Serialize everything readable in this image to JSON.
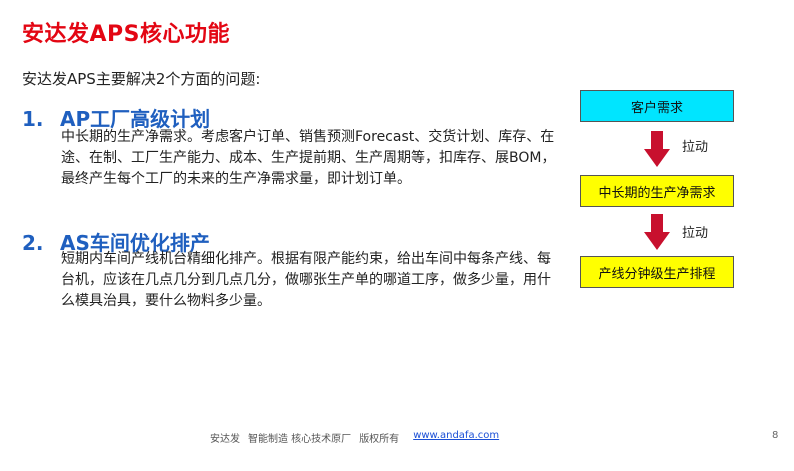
{
  "slide": {
    "title": "安达发APS核心功能",
    "intro": "安达发APS主要解决2个方面的问题:",
    "sections": [
      {
        "number": "1.",
        "heading": "AP工厂高级计划",
        "body": "中长期的生产净需求。考虑客户订单、销售预测Forecast、交货计划、库存、在途、在制、工厂生产能力、成本、生产提前期、生产周期等，扣库存、展BOM，最终产生每个工厂的未来的生产净需求量，即计划订单。"
      },
      {
        "number": "2.",
        "heading": "AS车间优化排产",
        "body": "短期内车间产线机台精细化排产。根据有限产能约束，给出车间中每条产线、每台机，应该在几点几分到几点几分，做哪张生产单的哪道工序，做多少量，用什么模具治具，要什么物料多少量。"
      }
    ]
  },
  "flow": {
    "boxes": [
      "客户需求",
      "中长期的生产净需求",
      "产线分钟级生产排程"
    ],
    "arrow_labels": [
      "拉动",
      "拉动"
    ],
    "colors": {
      "box1": "#00e5ff",
      "box2": "#ffff00",
      "box3": "#ffff00",
      "arrow": "#c8102e"
    }
  },
  "footer": {
    "company": "安达发",
    "tagline": "智能制造 核心技术原厂",
    "rights": "版权所有",
    "link": "www.andafa.com",
    "page_number": "8"
  },
  "colors": {
    "title": "#e30613",
    "heading": "#1f5fbf",
    "link": "#1a4fd6"
  }
}
